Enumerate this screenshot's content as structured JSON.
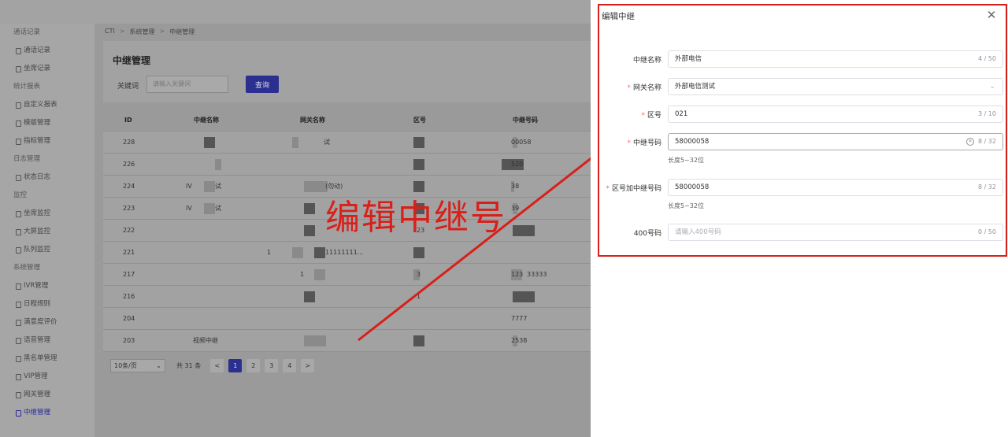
{
  "breadcrumb": [
    "CTI",
    "系统管理",
    "中继管理"
  ],
  "sidebar": {
    "entries": [
      {
        "type": "group",
        "label": "通话记录"
      },
      {
        "type": "item",
        "label": "通话记录"
      },
      {
        "type": "item",
        "label": "坐席记录"
      },
      {
        "type": "group",
        "label": "统计报表"
      },
      {
        "type": "item",
        "label": "自定义报表"
      },
      {
        "type": "item",
        "label": "模版管理"
      },
      {
        "type": "item",
        "label": "指标管理"
      },
      {
        "type": "group",
        "label": "日志管理"
      },
      {
        "type": "item",
        "label": "状态日志"
      },
      {
        "type": "group",
        "label": "监控"
      },
      {
        "type": "item",
        "label": "坐席监控"
      },
      {
        "type": "item",
        "label": "大屏监控"
      },
      {
        "type": "item",
        "label": "队列监控"
      },
      {
        "type": "group",
        "label": "系统管理"
      },
      {
        "type": "item",
        "label": "IVR管理"
      },
      {
        "type": "item",
        "label": "日程规则"
      },
      {
        "type": "item",
        "label": "满意度评价"
      },
      {
        "type": "item",
        "label": "语音管理"
      },
      {
        "type": "item",
        "label": "黑名单管理"
      },
      {
        "type": "item",
        "label": "VIP管理"
      },
      {
        "type": "item",
        "label": "网关管理"
      },
      {
        "type": "item",
        "label": "中继管理",
        "active": true
      }
    ]
  },
  "page": {
    "title": "中继管理",
    "keyword_label": "关键词",
    "keyword_placeholder": "请输入关键词",
    "query_button": "查询"
  },
  "table": {
    "columns": [
      "ID",
      "中继名称",
      "网关名称",
      "区号",
      "中继号码"
    ],
    "rows": [
      {
        "id": "228",
        "trunk": "",
        "gateway": "试",
        "area": "",
        "number": "00058"
      },
      {
        "id": "226",
        "trunk": "",
        "gateway": "",
        "area": "",
        "number": "520"
      },
      {
        "id": "224",
        "trunk": "IV",
        "trunk2": "试",
        "gateway": "(勿动)",
        "area": "",
        "number": "38"
      },
      {
        "id": "223",
        "trunk": "IV",
        "trunk2": "试",
        "gateway": "",
        "area": "",
        "number": "39"
      },
      {
        "id": "222",
        "trunk": "",
        "gateway": "",
        "area": "23",
        "number": ""
      },
      {
        "id": "221",
        "trunk": "1",
        "gateway": "11111111...",
        "area": "",
        "number": ""
      },
      {
        "id": "217",
        "trunk": "",
        "gateway": "1",
        "area": "3",
        "number": "123",
        "number2": "33333"
      },
      {
        "id": "216",
        "trunk": "",
        "gateway": "",
        "area": "1",
        "number": ""
      },
      {
        "id": "204",
        "trunk": "",
        "gateway": "",
        "area": "",
        "number": "7777"
      },
      {
        "id": "203",
        "trunk": "视频中继",
        "gateway": "",
        "area": "",
        "number": "2538"
      }
    ]
  },
  "pagination": {
    "page_size": "10条/页",
    "total": "共 31 条",
    "pages": [
      "1",
      "2",
      "3",
      "4"
    ],
    "current": "1"
  },
  "annotation": {
    "text": "编辑中继号",
    "color": "#d8201a"
  },
  "drawer": {
    "title": "编辑中继",
    "fields": [
      {
        "label": "中继名称",
        "required": false,
        "value": "外部电信",
        "count": "4 / 50"
      },
      {
        "label": "网关名称",
        "required": true,
        "value": "外部电信测试",
        "select": true
      },
      {
        "label": "区号",
        "required": true,
        "value": "021",
        "count": "3 / 10"
      },
      {
        "label": "中继号码",
        "required": true,
        "value": "58000058",
        "count": "8 / 32",
        "clearable": true,
        "hint": "长度5~32位"
      },
      {
        "label": "区号加中继号码",
        "required": true,
        "value": "58000058",
        "count": "8 / 32",
        "hint": "长度5~32位"
      },
      {
        "label": "400号码",
        "required": false,
        "placeholder": "请输入400号码",
        "count": "0 / 50"
      }
    ]
  }
}
